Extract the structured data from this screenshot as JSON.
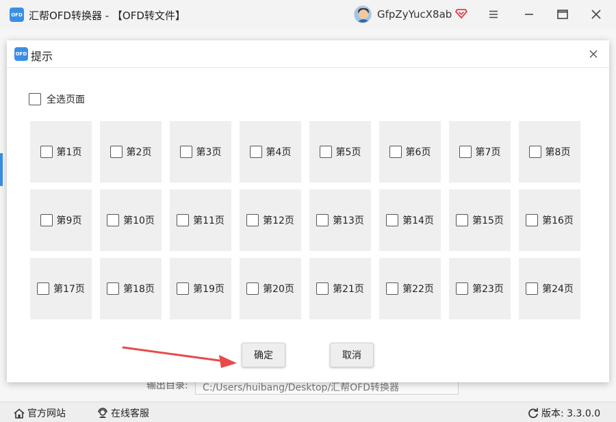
{
  "app": {
    "title": "汇帮OFD转换器 - 【OFD转文件】",
    "logo_text": "OFD",
    "user_name": "GfpZyYucX8ab",
    "accent_color": "#3a8ee6"
  },
  "output": {
    "label": "输出目录:",
    "path": "C:/Users/huibang/Desktop/汇帮OFD转换器"
  },
  "statusbar": {
    "website": "官方网站",
    "support": "在线客服",
    "version": "版本: 3.3.0.0"
  },
  "dialog": {
    "logo_text": "OFD",
    "title": "提示",
    "select_all_label": "全选页面",
    "pages": [
      "第1页",
      "第2页",
      "第3页",
      "第4页",
      "第5页",
      "第6页",
      "第7页",
      "第8页",
      "第9页",
      "第10页",
      "第11页",
      "第12页",
      "第13页",
      "第14页",
      "第15页",
      "第16页",
      "第17页",
      "第18页",
      "第19页",
      "第20页",
      "第21页",
      "第22页",
      "第23页",
      "第24页"
    ],
    "ok_label": "确定",
    "cancel_label": "取消"
  }
}
